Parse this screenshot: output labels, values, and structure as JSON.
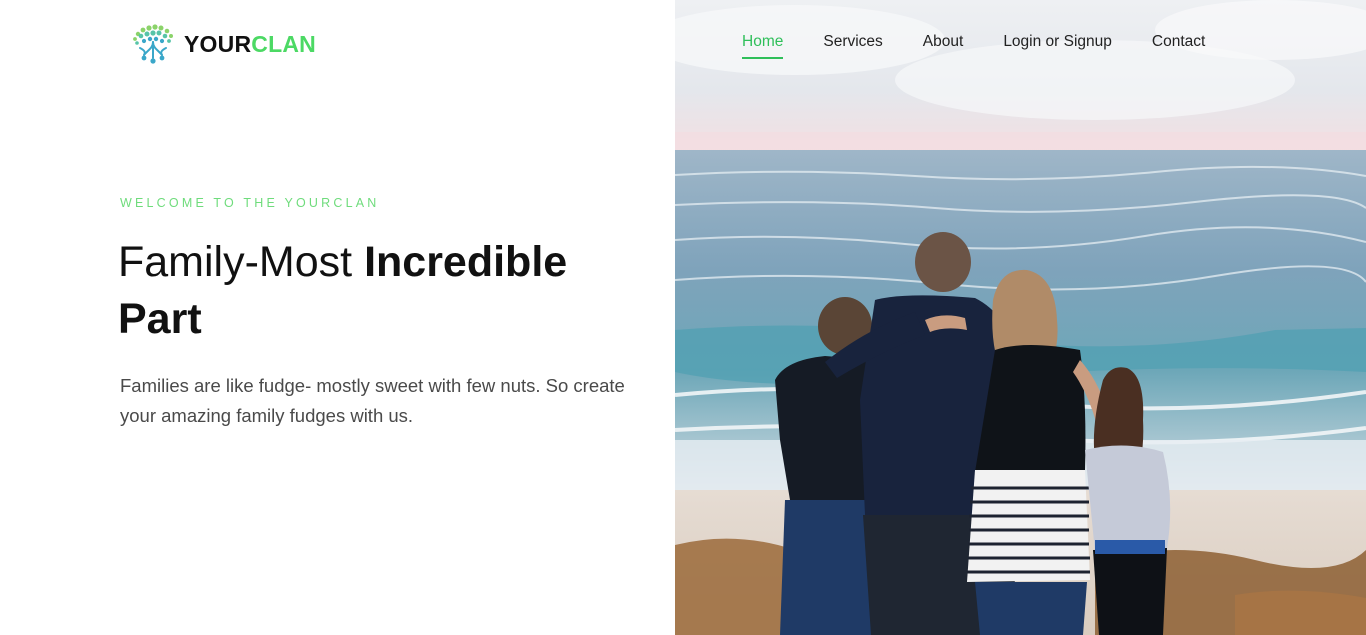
{
  "brand": {
    "name_part1": "YOUR",
    "name_part2": "CLAN",
    "colors": {
      "accent": "#4cd964",
      "nav_active": "#2fbf5a",
      "text_dark": "#111111"
    },
    "icon": "tree-logo-icon"
  },
  "nav": {
    "items": [
      {
        "label": "Home",
        "active": true
      },
      {
        "label": "Services",
        "active": false
      },
      {
        "label": "About",
        "active": false
      },
      {
        "label": "Login or Signup",
        "active": false
      },
      {
        "label": "Contact",
        "active": false
      }
    ]
  },
  "hero": {
    "eyebrow": "WELCOME TO THE YOURCLAN",
    "title_light": "Family-Most ",
    "title_bold": "Incredible Part",
    "lead": "Families are like fudge- mostly sweet with few nuts. So create your amazing family fudges with us.",
    "image": "family-at-beach-photo"
  }
}
